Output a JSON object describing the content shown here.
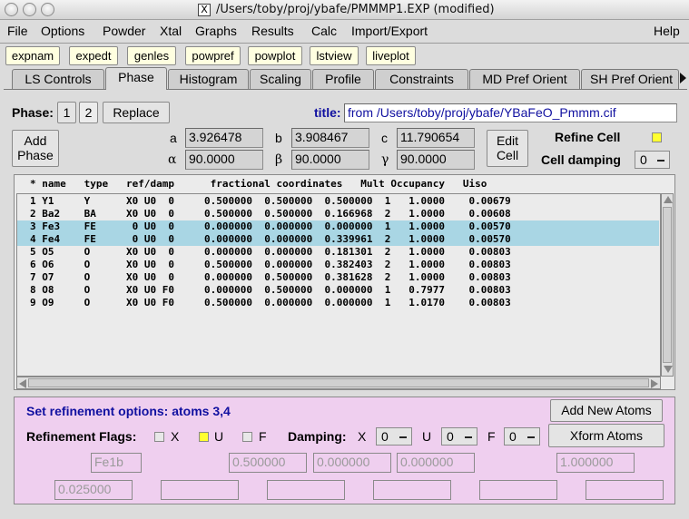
{
  "window": {
    "title": "/Users/toby/proj/ybafe/PMMMP1.EXP (modified)",
    "x_icon": "X"
  },
  "menu": [
    "File",
    "Options",
    "Powder",
    "Xtal",
    "Graphs",
    "Results",
    "Calc",
    "Import/Export"
  ],
  "menu_help": "Help",
  "programs": [
    "expnam",
    "expedt",
    "genles",
    "powpref",
    "powplot",
    "lstview",
    "liveplot"
  ],
  "tabs": [
    "LS Controls",
    "Phase",
    "Histogram",
    "Scaling",
    "Profile",
    "Constraints",
    "MD Pref Orient",
    "SH Pref Orient"
  ],
  "active_tab": "Phase",
  "phase": {
    "label": "Phase:",
    "buttons": [
      "1",
      "2"
    ],
    "replace": "Replace",
    "title_label": "title:",
    "title_value": "from /Users/toby/proj/ybafe/YBaFeO_Pmmm.cif",
    "add_phase": "Add\nPhase",
    "edit_cell": "Edit\nCell",
    "refine_cell": "Refine Cell",
    "cell_damping": "Cell damping",
    "cell_damping_value": "0",
    "cell": {
      "a_label": "a",
      "a": "3.926478",
      "b_label": "b",
      "b": "3.908467",
      "c_label": "c",
      "c": "11.790654",
      "alpha_label": "α",
      "alpha": "90.0000",
      "beta_label": "β",
      "beta": "90.0000",
      "gamma_label": "γ",
      "gamma": "90.0000"
    }
  },
  "atoms": {
    "header": "* name   type   ref/damp      fractional coordinates   Mult Occupancy   Uiso",
    "rows": [
      {
        "text": "1 Y1     Y      X0 U0  0     0.500000  0.500000  0.500000  1   1.0000    0.00679",
        "selected": false
      },
      {
        "text": "2 Ba2    BA     X0 U0  0     0.500000  0.500000  0.166968  2   1.0000    0.00608",
        "selected": false
      },
      {
        "text": "3 Fe3    FE      0 U0  0     0.000000  0.000000  0.000000  1   1.0000    0.00570",
        "selected": true
      },
      {
        "text": "4 Fe4    FE      0 U0  0     0.000000  0.000000  0.339961  2   1.0000    0.00570",
        "selected": true
      },
      {
        "text": "5 O5     O      X0 U0  0     0.000000  0.000000  0.181301  2   1.0000    0.00803",
        "selected": false
      },
      {
        "text": "6 O6     O      X0 U0  0     0.500000  0.000000  0.382403  2   1.0000    0.00803",
        "selected": false
      },
      {
        "text": "7 O7     O      X0 U0  0     0.000000  0.500000  0.381628  2   1.0000    0.00803",
        "selected": false
      },
      {
        "text": "8 O8     O      X0 U0 F0     0.000000  0.500000  0.000000  1   0.7977    0.00803",
        "selected": false
      },
      {
        "text": "9 O9     O      X0 U0 F0     0.500000  0.000000  0.000000  1   1.0170    0.00803",
        "selected": false
      }
    ]
  },
  "refine": {
    "set_options": "Set refinement options: atoms 3,4",
    "flags_label": "Refinement Flags:",
    "x": "X",
    "u": "U",
    "f": "F",
    "damping_label": "Damping:",
    "damp_x_label": "X",
    "damp_x": "0",
    "damp_u_label": "U",
    "damp_u": "0",
    "damp_f_label": "F",
    "damp_f": "0",
    "add_new_atoms": "Add New Atoms",
    "xform_atoms": "Xform Atoms",
    "name_field": "Fe1b",
    "x_field": "0.500000",
    "y_field": "0.000000",
    "z_field": "0.000000",
    "occ_field": "1.000000",
    "uiso_field": "0.025000"
  },
  "colors": {
    "title_text": "#1010a0",
    "selection": "#a9d6e4",
    "edit_pane": "#efcfef",
    "program_button": "#ffffe0",
    "checkbox_on": "#ffff30"
  }
}
